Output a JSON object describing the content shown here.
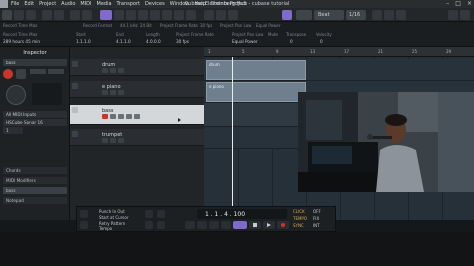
{
  "menubar": {
    "items": [
      "File",
      "Edit",
      "Project",
      "Audio",
      "MIDI",
      "Media",
      "Transport",
      "Devices",
      "Window",
      "Help",
      "Steinberg Hub"
    ],
    "window_title": "Cubase Elements Project - cubase tutorial"
  },
  "toolbar": {
    "mode_value": "Beat",
    "grid_value": "1/16"
  },
  "infoline": {
    "headers": [
      "Record Time Max",
      "Start",
      "End",
      "Length",
      "Project Frame Rate",
      "Project Pan Law",
      "Mute",
      "Transpose",
      "Velocity"
    ],
    "values": [
      "289 hours 45 min",
      "1.1.1.0",
      "4.1.1.0",
      "4.0.0.0",
      "30 fps",
      "Equal Power",
      "",
      "0",
      "0"
    ],
    "row1": [
      "Record Time Max",
      "Record Format",
      "44.1 kHz",
      "24 Bit",
      "Project Frame Rate",
      "30 fps",
      "Project Pan Law",
      "Equal Power"
    ]
  },
  "inspector": {
    "title": "Inspector",
    "track_name": "bass",
    "input_label": "All MIDI Inputs",
    "output_label": "HSCube Sonar 16",
    "channel": "1",
    "sections": [
      "Chords",
      "MIDI Modifiers",
      "bass",
      "Notepad"
    ]
  },
  "tracks": [
    {
      "name": "drum"
    },
    {
      "name": "e piano"
    },
    {
      "name": "bass"
    },
    {
      "name": "trumpet"
    }
  ],
  "ruler": {
    "marks": [
      "1",
      "5",
      "9",
      "13",
      "17",
      "21",
      "25",
      "29"
    ]
  },
  "parts": [
    {
      "label": "drum"
    },
    {
      "label": "e piano"
    }
  ],
  "transport": {
    "position": "1 . 1 . 4 . 100",
    "left_locator": "1 . 1 . 1 . 0",
    "labels": [
      "Punch In Out",
      "Start at Cursor",
      "Retry Pattern",
      "Tempo"
    ],
    "right_labels": [
      "CLICK",
      "TEMPO",
      "SYNC"
    ],
    "right_values": [
      "OFF",
      "FIX",
      "INT"
    ]
  },
  "colors": {
    "accent": "#7f6bc9",
    "record": "#c8352a",
    "selected_track": "#d4d7da",
    "part": "#6f7f8e"
  }
}
